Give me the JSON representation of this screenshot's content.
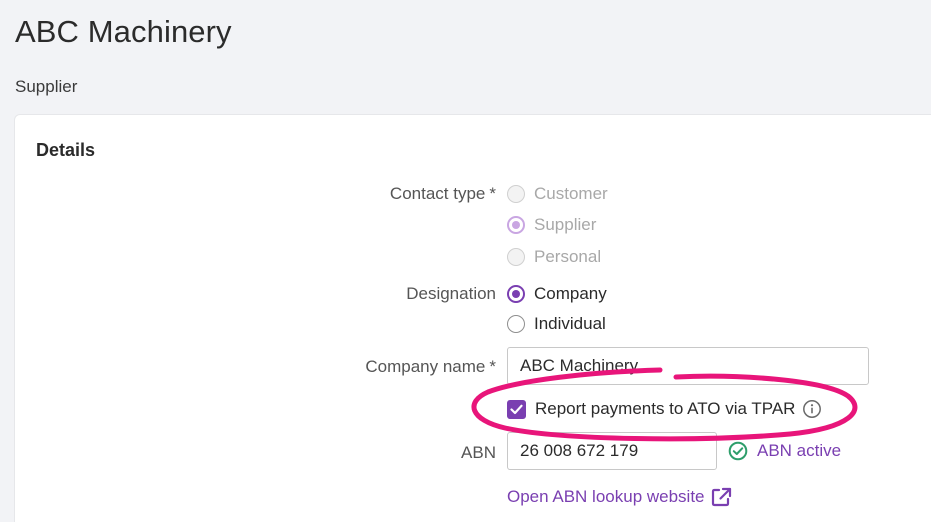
{
  "header": {
    "title": "ABC Machinery",
    "subtitle": "Supplier"
  },
  "details": {
    "section_title": "Details",
    "contact_type": {
      "label": "Contact type",
      "required_mark": "*",
      "options": [
        "Customer",
        "Supplier",
        "Personal"
      ],
      "selected": "Supplier"
    },
    "designation": {
      "label": "Designation",
      "options": [
        "Company",
        "Individual"
      ],
      "selected": "Company"
    },
    "company_name": {
      "label": "Company name",
      "required_mark": "*",
      "value": "ABC Machinery"
    },
    "tpar": {
      "label": "Report payments to ATO via TPAR",
      "checked": true
    },
    "abn": {
      "label": "ABN",
      "value": "26 008 672 179",
      "status": "ABN active"
    },
    "abn_lookup_link": "Open ABN lookup website"
  },
  "colors": {
    "accent": "#7a3fb1",
    "annotation": "#e8157a",
    "status_ok": "#2e9e6b"
  }
}
